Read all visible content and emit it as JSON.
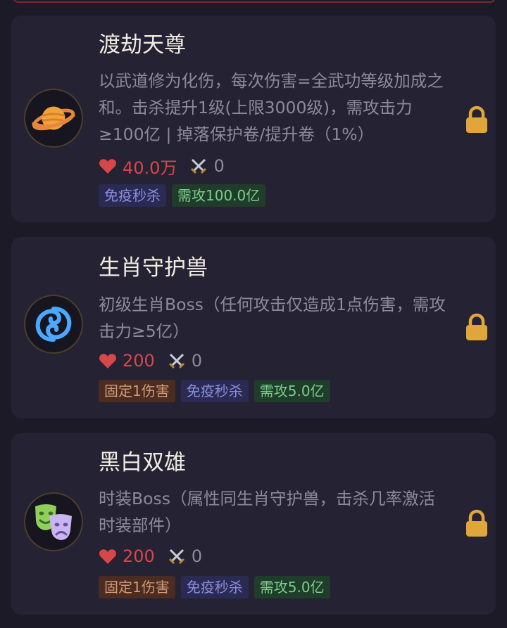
{
  "colors": {
    "background": "#1c1a27",
    "card": "#242233",
    "title": "#f2ede2",
    "description": "#8e8a99",
    "hp": "#d7474a",
    "lock": "#e0a63a",
    "tag_fixed_bg": "#4a2c22",
    "tag_immune_bg": "#2a2a52",
    "tag_atk_bg": "#1f3d2a"
  },
  "bosses": [
    {
      "icon": "saturn-icon",
      "title": "渡劫天尊",
      "description": "以武道修为化伤，每次伤害=全武功等级加成之和。击杀提升1级(上限3000级)，需攻击力≥100亿 | 掉落保护卷/提升卷（1%）",
      "hp": "40.0万",
      "attack": "0",
      "tags": [
        "免疫秒杀",
        "需攻100.0亿"
      ],
      "locked": true
    },
    {
      "icon": "cyclone-icon",
      "title": "生肖守护兽",
      "description": "初级生肖Boss（任何攻击仅造成1点伤害，需攻击力≥5亿）",
      "hp": "200",
      "attack": "0",
      "tags": [
        "固定1伤害",
        "免疫秒杀",
        "需攻5.0亿"
      ],
      "locked": true
    },
    {
      "icon": "theater-masks-icon",
      "title": "黑白双雄",
      "description": "时装Boss（属性同生肖守护兽，击杀几率激活时装部件）",
      "hp": "200",
      "attack": "0",
      "tags": [
        "固定1伤害",
        "免疫秒杀",
        "需攻5.0亿"
      ],
      "locked": true
    }
  ]
}
